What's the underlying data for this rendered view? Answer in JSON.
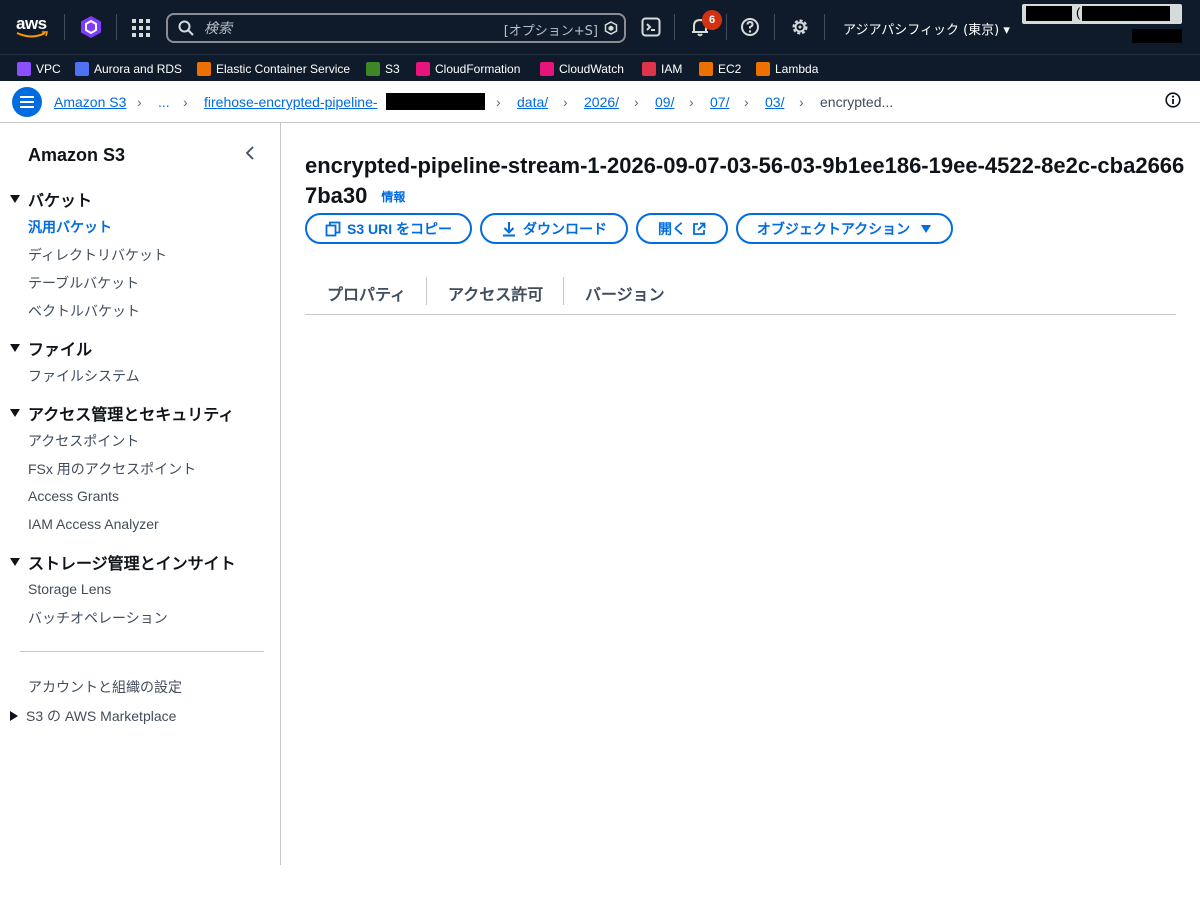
{
  "topnav": {
    "logo_text": "aws",
    "search_placeholder": "検索",
    "search_shortcut": "[オプション+S]",
    "notification_count": "6",
    "region": "アジアパシフィック (東京) ▾",
    "account_fragment": "("
  },
  "favorites": [
    {
      "label": "VPC",
      "color": "#8c4fff"
    },
    {
      "label": "Aurora and RDS",
      "color": "#4d72f3"
    },
    {
      "label": "Elastic Container Service",
      "color": "#ed7100"
    },
    {
      "label": "S3",
      "color": "#3f8624"
    },
    {
      "label": "CloudFormation",
      "color": "#e7157b"
    },
    {
      "label": "CloudWatch",
      "color": "#e7157b"
    },
    {
      "label": "IAM",
      "color": "#dd344c"
    },
    {
      "label": "EC2",
      "color": "#ed7100"
    },
    {
      "label": "Lambda",
      "color": "#ed7100"
    }
  ],
  "breadcrumb": {
    "items": [
      "Amazon S3",
      "...",
      "firehose-encrypted-pipeline-",
      "data/",
      "2026/",
      "09/",
      "07/",
      "03/"
    ],
    "current": "encrypted..."
  },
  "sidebar": {
    "title": "Amazon S3",
    "groups": [
      {
        "label": "バケット",
        "items": [
          "汎用バケット",
          "ディレクトリバケット",
          "テーブルバケット",
          "ベクトルバケット"
        ]
      },
      {
        "label": "ファイル",
        "items": [
          "ファイルシステム"
        ]
      },
      {
        "label": "アクセス管理とセキュリティ",
        "items": [
          "アクセスポイント",
          "FSx 用のアクセスポイント",
          "Access Grants",
          "IAM Access Analyzer"
        ]
      },
      {
        "label": "ストレージ管理とインサイト",
        "items": [
          "Storage Lens",
          "バッチオペレーション"
        ]
      }
    ],
    "footer_items": [
      "アカウントと組織の設定",
      "S3 の AWS Marketplace"
    ]
  },
  "main": {
    "title": "encrypted-pipeline-stream-1-2026-09-07-03-56-03-9b1ee186-19ee-4522-8e2c-cba26667ba30",
    "info_label": "情報",
    "buttons": {
      "copy_uri": "S3 URI をコピー",
      "download": "ダウンロード",
      "open": "開く",
      "object_actions": "オブジェクトアクション"
    },
    "tabs": [
      "プロパティ",
      "アクセス許可",
      "バージョン"
    ]
  }
}
